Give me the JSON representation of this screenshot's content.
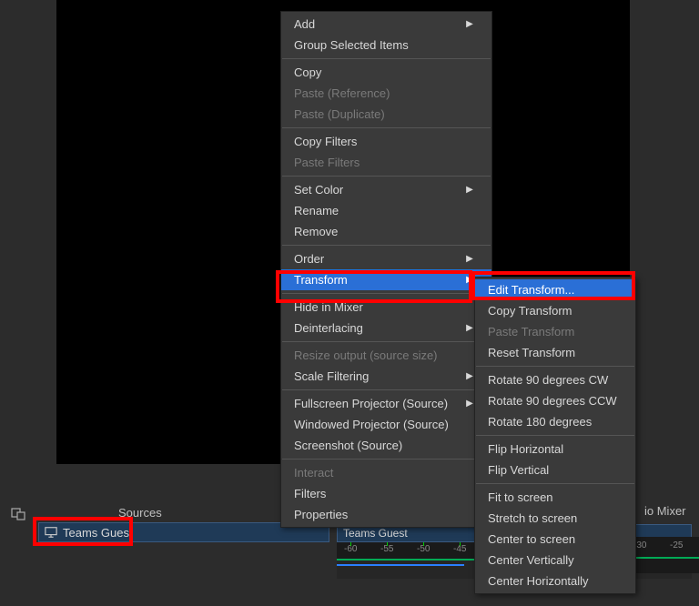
{
  "tabs": {
    "sources": "Sources",
    "audio_mixer": "io Mixer"
  },
  "source": {
    "name": "Teams Guest"
  },
  "timeline": {
    "header": "Teams Guest",
    "ticks": [
      "-60",
      "-55",
      "-50",
      "-45"
    ],
    "ticks2": [
      "-30",
      "-25"
    ]
  },
  "menu": {
    "add": "Add",
    "group": "Group Selected Items",
    "copy": "Copy",
    "paste_ref": "Paste (Reference)",
    "paste_dup": "Paste (Duplicate)",
    "copy_filters": "Copy Filters",
    "paste_filters": "Paste Filters",
    "set_color": "Set Color",
    "rename": "Rename",
    "remove": "Remove",
    "order": "Order",
    "transform": "Transform",
    "hide_mixer": "Hide in Mixer",
    "deinterlacing": "Deinterlacing",
    "resize_output": "Resize output (source size)",
    "scale_filtering": "Scale Filtering",
    "fullscreen_proj": "Fullscreen Projector (Source)",
    "windowed_proj": "Windowed Projector (Source)",
    "screenshot": "Screenshot (Source)",
    "interact": "Interact",
    "filters": "Filters",
    "properties": "Properties"
  },
  "submenu": {
    "edit_transform": "Edit Transform...",
    "copy_transform": "Copy Transform",
    "paste_transform": "Paste Transform",
    "reset_transform": "Reset Transform",
    "rotate_cw": "Rotate 90 degrees CW",
    "rotate_ccw": "Rotate 90 degrees CCW",
    "rotate_180": "Rotate 180 degrees",
    "flip_h": "Flip Horizontal",
    "flip_v": "Flip Vertical",
    "fit": "Fit to screen",
    "stretch": "Stretch to screen",
    "center": "Center to screen",
    "center_v": "Center Vertically",
    "center_h": "Center Horizontally"
  }
}
